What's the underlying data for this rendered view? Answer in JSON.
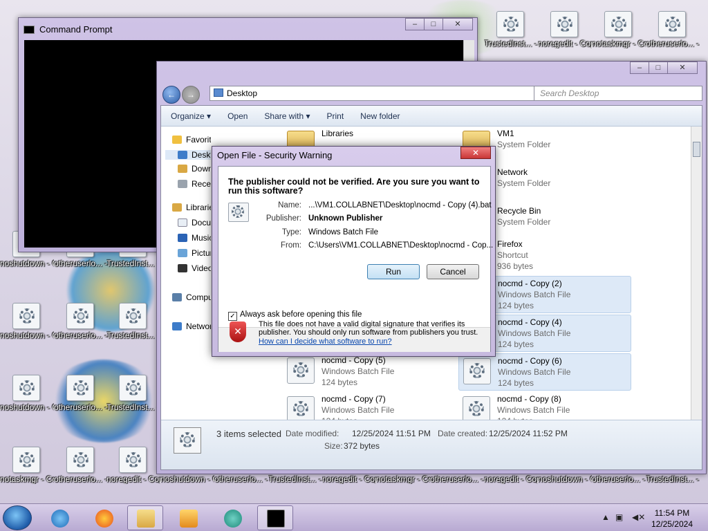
{
  "desktop": {
    "icons": [
      {
        "label": "TrustedInst... - Copy (7)"
      },
      {
        "label": "noregedit - Copy (18)"
      },
      {
        "label": "notaskmgr - Copy (2)"
      },
      {
        "label": "otheruserlo... - Copy (19)"
      },
      {
        "label": "noshutdown - Copy (17)"
      },
      {
        "label": "otheruserlo... - Copy (2)"
      },
      {
        "label": "TrustedInst... - Copy (19)"
      },
      {
        "label": "noshutdown - Copy (24)"
      },
      {
        "label": "otheruserlo... - Copy (9)"
      },
      {
        "label": "TrustedInst... - Copy (26)"
      },
      {
        "label": "noshutdown - Copy (21)"
      },
      {
        "label": "otheruserlo... - Copy (16)"
      },
      {
        "label": "TrustedInst... - Copy (33)"
      },
      {
        "label": "notaskmgr - Copy (6)"
      },
      {
        "label": "otheruserlo... - Copy (23)"
      },
      {
        "label": "noregedit - Copy (2)"
      },
      {
        "label": "noshutdown - Copy (13)"
      },
      {
        "label": "otheruserlo... - Copy (3)"
      },
      {
        "label": "TrustedInst... - Copy (20)"
      },
      {
        "label": "noregedit - Copy (31)"
      },
      {
        "label": "notaskmgr - Copy (13)"
      },
      {
        "label": "otheruserlo... - Copy (32)"
      },
      {
        "label": "noregedit - Copy (11)"
      },
      {
        "label": "noshutdown - Copy (27)"
      },
      {
        "label": "otheruserlo... - Copy (12)"
      },
      {
        "label": "TrustedInst... - Copy (29)"
      }
    ]
  },
  "cmd": {
    "title": "Command Prompt"
  },
  "explorer": {
    "address": "Desktop",
    "search_placeholder": "Search Desktop",
    "toolbar": {
      "organize": "Organize ▾",
      "open": "Open",
      "share": "Share with ▾",
      "print": "Print",
      "newfolder": "New folder"
    },
    "nav": {
      "favorites": "Favorites",
      "desktop": "Desktop",
      "downloads": "Downloads",
      "recent": "Recent Places",
      "libraries": "Libraries",
      "documents": "Documents",
      "music": "Music",
      "pictures": "Pictures",
      "videos": "Videos",
      "computer": "Computer",
      "network": "Network"
    },
    "files": [
      {
        "name": "Libraries",
        "type": "",
        "size": ""
      },
      {
        "name": "VM1",
        "type": "System Folder",
        "size": ""
      },
      {
        "name": "Network",
        "type": "System Folder",
        "size": ""
      },
      {
        "name": "Recycle Bin",
        "type": "System Folder",
        "size": ""
      },
      {
        "name": "Firefox",
        "type": "Shortcut",
        "size": "936 bytes"
      },
      {
        "name": "nocmd - Copy (2)",
        "type": "Windows Batch File",
        "size": "124 bytes"
      },
      {
        "name": "nocmd - Copy (4)",
        "type": "Windows Batch File",
        "size": "124 bytes"
      },
      {
        "name": "nocmd - Copy (5)",
        "type": "Windows Batch File",
        "size": "124 bytes"
      },
      {
        "name": "nocmd - Copy (6)",
        "type": "Windows Batch File",
        "size": "124 bytes"
      },
      {
        "name": "nocmd - Copy (7)",
        "type": "Windows Batch File",
        "size": "124 bytes"
      },
      {
        "name": "nocmd - Copy (8)",
        "type": "Windows Batch File",
        "size": "124 bytes"
      }
    ],
    "details": {
      "selected": "3 items selected",
      "modified_label": "Date modified:",
      "modified": "12/25/2024 11:51 PM",
      "created_label": "Date created:",
      "created": "12/25/2024 11:52 PM",
      "size_label": "Size:",
      "size": "372 bytes"
    }
  },
  "dialog": {
    "title": "Open File - Security Warning",
    "heading": "The publisher could not be verified.  Are you sure you want to run this software?",
    "name_label": "Name:",
    "name": "...\\VM1.COLLABNET\\Desktop\\nocmd - Copy (4).bat",
    "publisher_label": "Publisher:",
    "publisher": "Unknown Publisher",
    "type_label": "Type:",
    "type": "Windows Batch File",
    "from_label": "From:",
    "from": "C:\\Users\\VM1.COLLABNET\\Desktop\\nocmd - Cop...",
    "run": "Run",
    "cancel": "Cancel",
    "always_ask": "Always ask before opening this file",
    "warning": "This file does not have a valid digital signature that verifies its publisher.  You should only run software from publishers you trust.",
    "link": "How can I decide what software to run?"
  },
  "taskbar": {
    "time": "11:54 PM",
    "date": "12/25/2024"
  }
}
